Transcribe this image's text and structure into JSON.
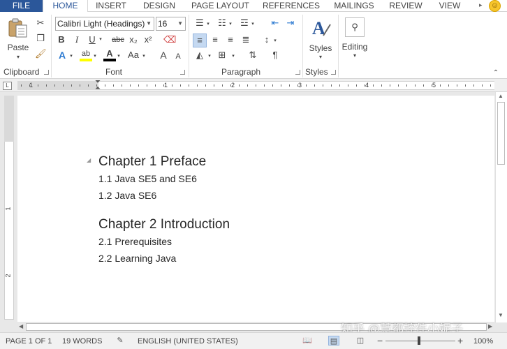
{
  "tabs": {
    "file": "FILE",
    "home": "HOME",
    "insert": "INSERT",
    "design": "DESIGN",
    "page_layout": "PAGE LAYOUT",
    "references": "REFERENCES",
    "mailings": "MAILINGS",
    "review": "REVIEW",
    "view": "VIEW"
  },
  "ribbon": {
    "clipboard": {
      "label": "Clipboard",
      "paste": "Paste"
    },
    "font": {
      "label": "Font",
      "font_name": "Calibri Light (Headings)",
      "font_size": "16",
      "bold": "B",
      "italic": "I",
      "underline": "U",
      "strike": "abc",
      "subscript": "x₂",
      "superscript": "x²",
      "text_effects": "A",
      "highlight": "ab",
      "font_color": "A",
      "change_case": "Aa",
      "grow": "A",
      "shrink": "A"
    },
    "paragraph": {
      "label": "Paragraph",
      "pilcrow": "¶"
    },
    "styles": {
      "label": "Styles",
      "button": "Styles"
    },
    "editing": {
      "button": "Editing"
    }
  },
  "ruler": {
    "numbers": [
      "1",
      "1",
      "2",
      "3",
      "4",
      "5"
    ],
    "vertical_numbers": [
      "1",
      "2"
    ]
  },
  "document": {
    "lines": [
      {
        "text": "Chapter 1 Preface",
        "level": "h1"
      },
      {
        "text": "1.1 Java SE5 and SE6",
        "level": "h2"
      },
      {
        "text": "1.2 Java SE6",
        "level": "h2"
      },
      {
        "text": "Chapter 2 Introduction",
        "level": "h1"
      },
      {
        "text": "2.1 Prerequisites",
        "level": "h2"
      },
      {
        "text": "2.2 Learning Java",
        "level": "h2"
      }
    ]
  },
  "watermark": "知乎 @慧都控件小妮子",
  "status": {
    "page": "PAGE 1 OF 1",
    "words": "19 WORDS",
    "language": "ENGLISH (UNITED STATES)",
    "zoom_minus": "−",
    "zoom_plus": "+",
    "zoom": "100%"
  },
  "colors": {
    "file_tab": "#2b579a",
    "accent": "#2b579a",
    "font_color_bar": "#000000",
    "highlight_bar": "#ffff00",
    "styles_icon": "#2b579a"
  }
}
